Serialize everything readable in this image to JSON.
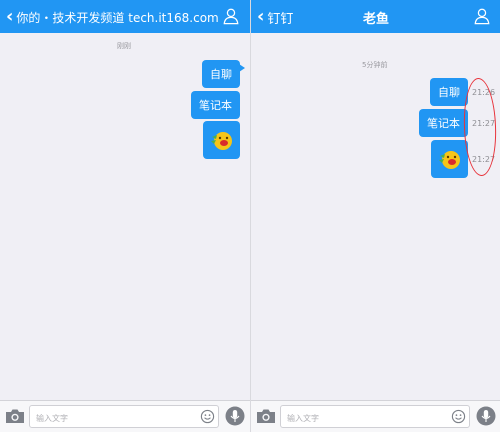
{
  "left": {
    "header": {
      "back_label": "你的・技术开发频道 tech.it168.com",
      "title": ""
    },
    "timestamp": "刚刚",
    "messages": [
      {
        "kind": "text",
        "text": "自聊"
      },
      {
        "kind": "text",
        "text": "笔记本"
      },
      {
        "kind": "emoji",
        "icon": "crying-face-emoji-icon"
      }
    ],
    "input": {
      "placeholder": "输入文字"
    }
  },
  "right": {
    "header": {
      "back_label": "钉钉",
      "title": "老鱼"
    },
    "timestamp": "5分钟前",
    "messages": [
      {
        "kind": "text",
        "text": "自聊",
        "time": "21:26"
      },
      {
        "kind": "text",
        "text": "笔记本",
        "time": "21:27"
      },
      {
        "kind": "emoji",
        "icon": "crying-face-emoji-icon",
        "time": "21:27"
      }
    ],
    "input": {
      "placeholder": "输入文字"
    }
  },
  "colors": {
    "brand": "#2196f3",
    "bubble": "#2196f3",
    "annotation": "#e8323a",
    "background": "#f0eff5"
  }
}
